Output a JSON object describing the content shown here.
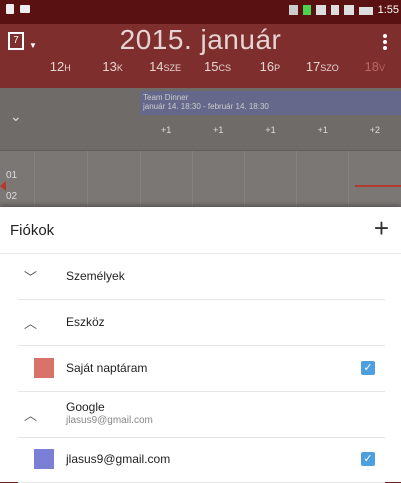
{
  "status_bar": {
    "time": "1:55"
  },
  "header": {
    "title": "2015. január",
    "calendar_icon_digit": "7",
    "days": [
      {
        "num": "12",
        "abbr": "H"
      },
      {
        "num": "13",
        "abbr": "K"
      },
      {
        "num": "14",
        "abbr": "SZE"
      },
      {
        "num": "15",
        "abbr": "CS"
      },
      {
        "num": "16",
        "abbr": "P"
      },
      {
        "num": "17",
        "abbr": "SZO"
      },
      {
        "num": "18",
        "abbr": "V"
      }
    ]
  },
  "grid": {
    "event": {
      "title": "Team Dinner",
      "time": "január 14. 18:30 - február 14. 18:30"
    },
    "plus_counts": [
      "+1",
      "+1",
      "+1",
      "+1",
      "+2"
    ],
    "hours": [
      "01",
      "02"
    ]
  },
  "sheet": {
    "title": "Fiókok",
    "add_label": "+",
    "rows": [
      {
        "label": "Személyek",
        "expanded": false
      },
      {
        "label": "Eszköz",
        "expanded": true
      },
      {
        "label": "Saját naptáram",
        "color": "#d9736a",
        "checked": true
      },
      {
        "label": "Google",
        "sub": "jlasus9@gmail.com",
        "expanded": true
      },
      {
        "label": "jlasus9@gmail.com",
        "color": "#7b7fd6",
        "checked": true
      }
    ]
  }
}
